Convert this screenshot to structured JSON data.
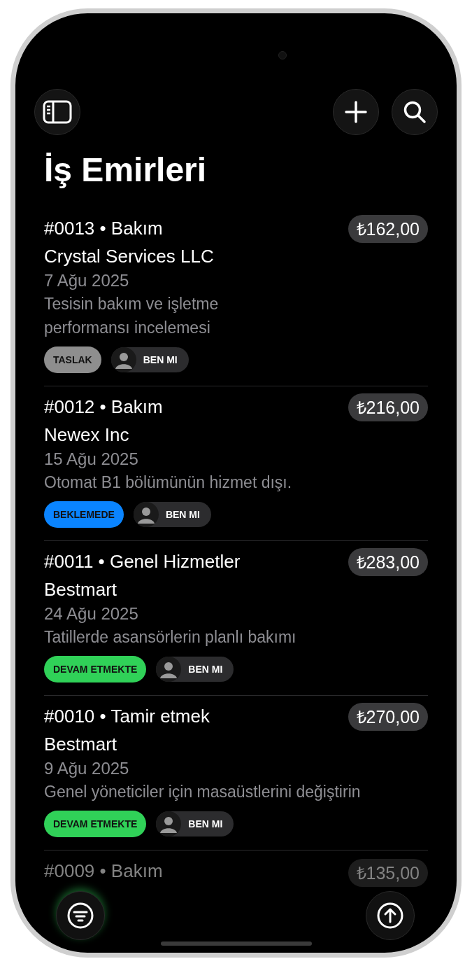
{
  "title": "İş Emirleri",
  "orders": [
    {
      "title": "#0013 • Bakım",
      "price": "₺162,00",
      "customer": "Crystal Services LLC",
      "date": "7 Ağu 2025",
      "description": "Tesisin bakım ve işletme performansı incelemesi",
      "status": {
        "label": "TASLAK",
        "color": "#8e8e8e"
      },
      "assignee": "BEN MI"
    },
    {
      "title": "#0012 • Bakım",
      "price": "₺216,00",
      "customer": "Newex Inc",
      "date": "15 Ağu 2025",
      "description": "Otomat B1 bölümünün hizmet dışı.",
      "status": {
        "label": "BEKLEMEDE",
        "color": "#0a84ff"
      },
      "assignee": "BEN MI"
    },
    {
      "title": "#0011 • Genel Hizmetler",
      "price": "₺283,00",
      "customer": "Bestmart",
      "date": "24 Ağu 2025",
      "description": "Tatillerde asansörlerin planlı bakımı",
      "status": {
        "label": "DEVAM ETMEKTE",
        "color": "#30d158"
      },
      "assignee": "BEN MI"
    },
    {
      "title": "#0010 • Tamir etmek",
      "price": "₺270,00",
      "customer": "Bestmart",
      "date": "9 Ağu 2025",
      "description": "Genel yöneticiler için masaüstlerini değiştirin",
      "status": {
        "label": "DEVAM ETMEKTE",
        "color": "#30d158"
      },
      "assignee": "BEN MI"
    }
  ],
  "partial_order": {
    "title": "#0009 • Bakım",
    "price": "₺135,00"
  }
}
